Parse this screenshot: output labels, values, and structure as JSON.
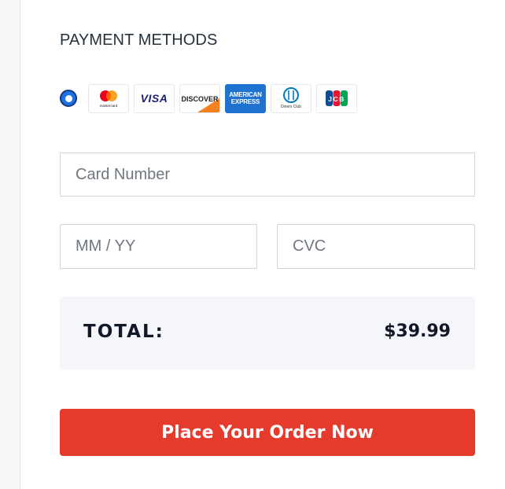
{
  "payment": {
    "title": "PAYMENT METHODS",
    "cards": [
      {
        "name": "Mastercard",
        "label": "mastercard",
        "icon": "mastercard-icon"
      },
      {
        "name": "Visa",
        "label": "VISA",
        "icon": "visa-icon"
      },
      {
        "name": "Discover",
        "label": "DISCOVER",
        "icon": "discover-icon"
      },
      {
        "name": "American Express",
        "label": [
          "AMERICAN",
          "EXPRESS"
        ],
        "icon": "amex-icon"
      },
      {
        "name": "Diners Club",
        "label": "Diners Club",
        "icon": "diners-club-icon"
      },
      {
        "name": "JCB",
        "label": "JCB",
        "icon": "jcb-icon"
      }
    ],
    "selected_radio": true
  },
  "form": {
    "card_number_placeholder": "Card Number",
    "expiry_placeholder": "MM / YY",
    "cvc_placeholder": "CVC"
  },
  "summary": {
    "total_label": "TOTAL:",
    "total_value": "$39.99"
  },
  "actions": {
    "place_order_label": "Place Your Order Now"
  },
  "colors": {
    "accent_button": "#e43b2d",
    "radio_selected": "#1f6fe8",
    "amex_blue": "#1f72cd",
    "visa_blue": "#1a1f71",
    "discover_orange": "#f58220",
    "mastercard_red": "#eb001b",
    "mastercard_yellow": "#f79e1b"
  }
}
